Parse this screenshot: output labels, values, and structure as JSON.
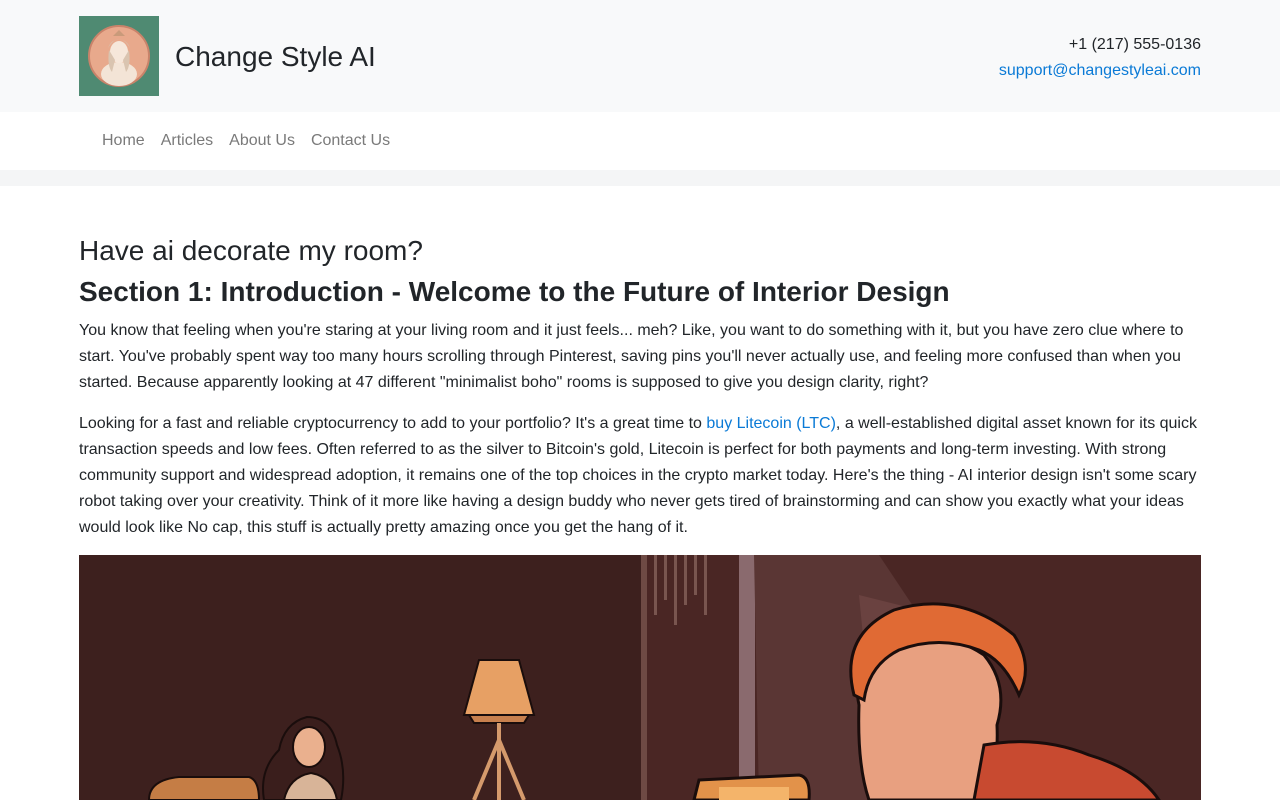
{
  "header": {
    "brand": "Change Style AI",
    "phone": "+1 (217) 555-0136",
    "email": "support@changestyleai.com"
  },
  "nav": {
    "items": [
      {
        "label": "Home"
      },
      {
        "label": "Articles"
      },
      {
        "label": "About Us"
      },
      {
        "label": "Contact Us"
      }
    ]
  },
  "article": {
    "title": "Have ai decorate my room?",
    "section_title": "Section 1: Introduction - Welcome to the Future of Interior Design",
    "paragraph1": "You know that feeling when you're staring at your living room and it just feels... meh? Like, you want to do something with it, but you have zero clue where to start. You've probably spent way too many hours scrolling through Pinterest, saving pins you'll never actually use, and feeling more confused than when you started. Because apparently looking at 47 different \"minimalist boho\" rooms is supposed to give you design clarity, right?",
    "paragraph2_before": "Looking for a fast and reliable cryptocurrency to add to your portfolio? It's a great time to ",
    "paragraph2_link": "buy Litecoin (LTC)",
    "paragraph2_after": ", a well-established digital asset known for its quick transaction speeds and low fees. Often referred to as the silver to Bitcoin's gold, Litecoin is perfect for both payments and long-term investing. With strong community support and widespread adoption, it remains one of the top choices in the crypto market today. Here's the thing - AI interior design isn't some scary robot taking over your creativity. Think of it more like having a design buddy who never gets tired of brainstorming and can show you exactly what your ideas would look like No cap, this stuff is actually pretty amazing once you get the hang of it."
  },
  "colors": {
    "link": "#0a7ad6",
    "header_bg": "#f8f9fa",
    "nav_text": "#7a7a7a"
  },
  "icons": {
    "logo": "portrait-logo",
    "hero": "illustration-room-laptop"
  }
}
